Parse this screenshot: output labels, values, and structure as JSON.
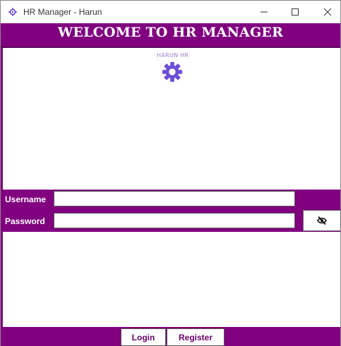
{
  "window": {
    "title": "HR Manager - Harun",
    "icon": "gear-icon",
    "controls": {
      "minimize": "minimize-icon",
      "maximize": "maximize-icon",
      "close": "close-icon"
    }
  },
  "header": {
    "title": "WELCOME TO HR MANAGER"
  },
  "logo": {
    "text": "HARUN HR",
    "icon": "gear-icon"
  },
  "form": {
    "username_label": "Username",
    "username_value": "",
    "password_label": "Password",
    "password_value": "",
    "toggle_icon": "eye-slash-icon"
  },
  "footer": {
    "login_label": "Login",
    "register_label": "Register"
  },
  "colors": {
    "brand": "#800080",
    "logo_gear": "#6b4fd8",
    "logo_text": "#9c7cd0"
  }
}
